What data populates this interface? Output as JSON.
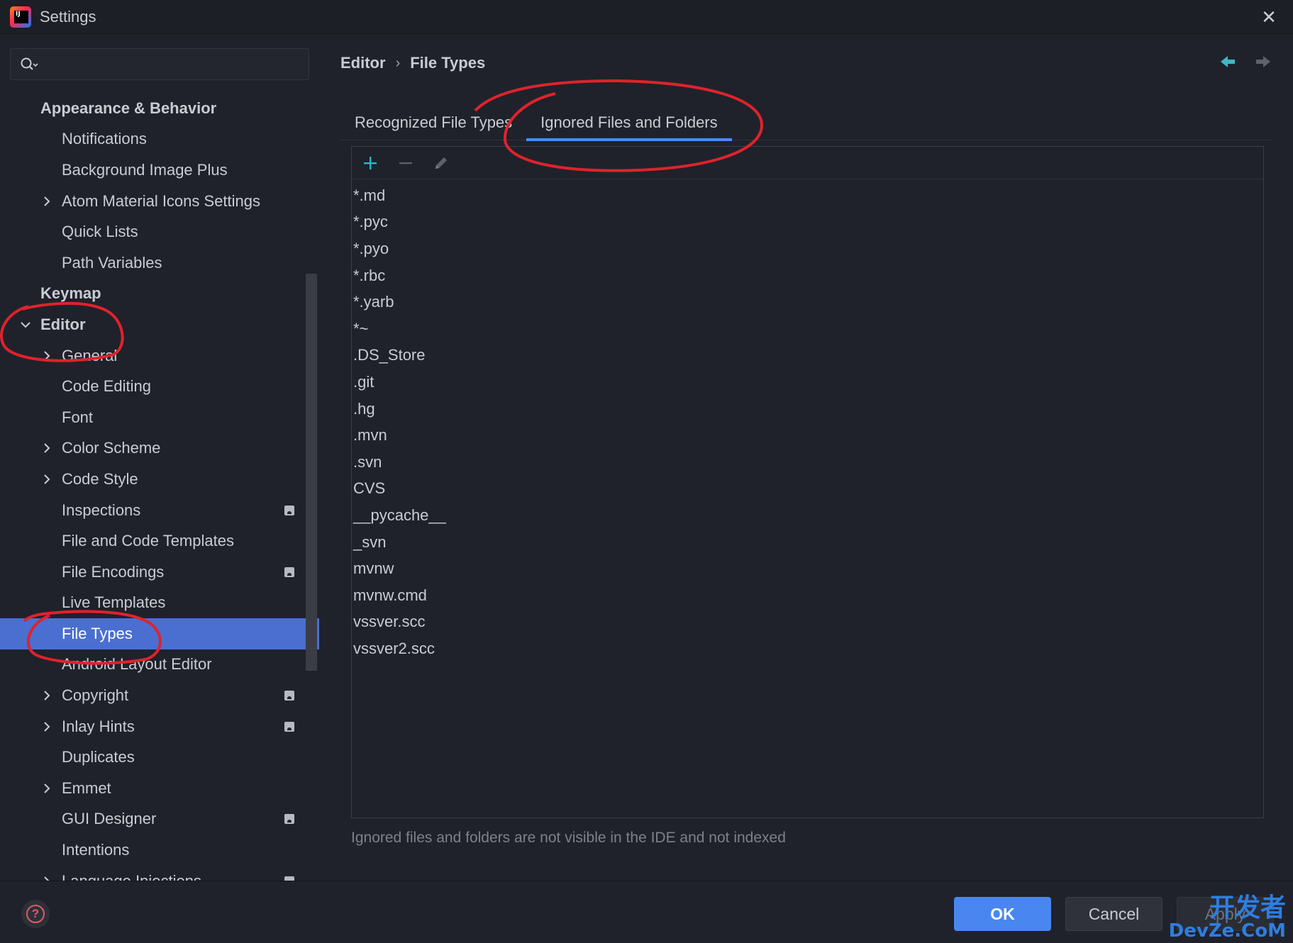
{
  "window": {
    "title": "Settings",
    "close_glyph": "✕"
  },
  "search": {
    "placeholder": "",
    "value": ""
  },
  "sidebar": {
    "items": [
      {
        "label": "Appearance & Behavior",
        "level": 0,
        "bold": true,
        "chevron": "none",
        "badge": false,
        "selected": false
      },
      {
        "label": "Notifications",
        "level": 1,
        "bold": false,
        "chevron": "none",
        "badge": false,
        "selected": false
      },
      {
        "label": "Background Image Plus",
        "level": 1,
        "bold": false,
        "chevron": "none",
        "badge": false,
        "selected": false
      },
      {
        "label": "Atom Material Icons Settings",
        "level": 1,
        "bold": false,
        "chevron": "right",
        "badge": false,
        "selected": false
      },
      {
        "label": "Quick Lists",
        "level": 1,
        "bold": false,
        "chevron": "none",
        "badge": false,
        "selected": false
      },
      {
        "label": "Path Variables",
        "level": 1,
        "bold": false,
        "chevron": "none",
        "badge": false,
        "selected": false
      },
      {
        "label": "Keymap",
        "level": 0,
        "bold": true,
        "chevron": "none",
        "badge": false,
        "selected": false
      },
      {
        "label": "Editor",
        "level": 0,
        "bold": true,
        "chevron": "down",
        "badge": false,
        "selected": false
      },
      {
        "label": "General",
        "level": 1,
        "bold": false,
        "chevron": "right",
        "badge": false,
        "selected": false
      },
      {
        "label": "Code Editing",
        "level": 1,
        "bold": false,
        "chevron": "none",
        "badge": false,
        "selected": false
      },
      {
        "label": "Font",
        "level": 1,
        "bold": false,
        "chevron": "none",
        "badge": false,
        "selected": false
      },
      {
        "label": "Color Scheme",
        "level": 1,
        "bold": false,
        "chevron": "right",
        "badge": false,
        "selected": false
      },
      {
        "label": "Code Style",
        "level": 1,
        "bold": false,
        "chevron": "right",
        "badge": false,
        "selected": false
      },
      {
        "label": "Inspections",
        "level": 1,
        "bold": false,
        "chevron": "none",
        "badge": true,
        "selected": false
      },
      {
        "label": "File and Code Templates",
        "level": 1,
        "bold": false,
        "chevron": "none",
        "badge": false,
        "selected": false
      },
      {
        "label": "File Encodings",
        "level": 1,
        "bold": false,
        "chevron": "none",
        "badge": true,
        "selected": false
      },
      {
        "label": "Live Templates",
        "level": 1,
        "bold": false,
        "chevron": "none",
        "badge": false,
        "selected": false
      },
      {
        "label": "File Types",
        "level": 1,
        "bold": false,
        "chevron": "none",
        "badge": false,
        "selected": true
      },
      {
        "label": "Android Layout Editor",
        "level": 1,
        "bold": false,
        "chevron": "none",
        "badge": false,
        "selected": false
      },
      {
        "label": "Copyright",
        "level": 1,
        "bold": false,
        "chevron": "right",
        "badge": true,
        "selected": false
      },
      {
        "label": "Inlay Hints",
        "level": 1,
        "bold": false,
        "chevron": "right",
        "badge": true,
        "selected": false
      },
      {
        "label": "Duplicates",
        "level": 1,
        "bold": false,
        "chevron": "none",
        "badge": false,
        "selected": false
      },
      {
        "label": "Emmet",
        "level": 1,
        "bold": false,
        "chevron": "right",
        "badge": false,
        "selected": false
      },
      {
        "label": "GUI Designer",
        "level": 1,
        "bold": false,
        "chevron": "none",
        "badge": true,
        "selected": false
      },
      {
        "label": "Intentions",
        "level": 1,
        "bold": false,
        "chevron": "none",
        "badge": false,
        "selected": false
      },
      {
        "label": "Language Injections",
        "level": 1,
        "bold": false,
        "chevron": "right",
        "badge": true,
        "selected": false
      }
    ]
  },
  "breadcrumb": {
    "parent": "Editor",
    "separator": "›",
    "current": "File Types"
  },
  "tabs": [
    {
      "label": "Recognized File Types",
      "active": false
    },
    {
      "label": "Ignored Files and Folders",
      "active": true
    }
  ],
  "ignored_list": {
    "items": [
      "*.md",
      "*.pyc",
      "*.pyo",
      "*.rbc",
      "*.yarb",
      "*~",
      ".DS_Store",
      ".git",
      ".hg",
      ".mvn",
      ".svn",
      "CVS",
      "__pycache__",
      "_svn",
      "mvnw",
      "mvnw.cmd",
      "vssver.scc",
      "vssver2.scc"
    ],
    "hint": "Ignored files and folders are not visible in the IDE and not indexed"
  },
  "footer": {
    "help_glyph": "?",
    "ok_label": "OK",
    "cancel_label": "Cancel",
    "apply_label": "Apply",
    "watermark_main": "开发者",
    "watermark_sub": "DevZe.CoM"
  },
  "colors": {
    "background": "#1f222a",
    "selection": "#4a6fd0",
    "accent": "#4a8cf7",
    "add_icon": "#2fb5c9",
    "annotation": "#e0222c"
  },
  "icons": {
    "search": "search-icon",
    "back": "back-arrow-icon",
    "forward": "forward-arrow-icon",
    "add": "plus-icon",
    "remove": "minus-icon",
    "edit": "pencil-icon"
  }
}
